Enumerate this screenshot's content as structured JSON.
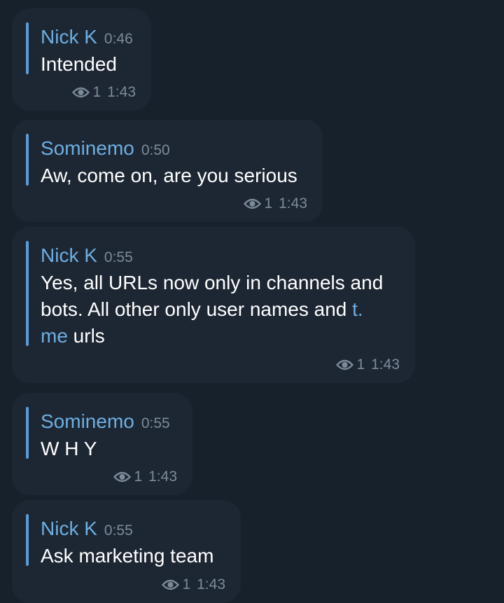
{
  "messages": [
    {
      "sender": "Nick K",
      "fwd_time": "0:46",
      "text": "Intended",
      "views": "1",
      "time": "1:43"
    },
    {
      "sender": "Sominemo",
      "fwd_time": "0:50",
      "text": "Aw, come on, are you serious",
      "views": "1",
      "time": "1:43"
    },
    {
      "sender": "Nick K",
      "fwd_time": "0:55",
      "text_line1": "Yes, all URLs now only in channels and",
      "text_line2_pre": "bots. All other only user names and ",
      "text_line2_link": "t.",
      "text_line3_link": "me",
      "text_line3_post": " urls",
      "views": "1",
      "time": "1:43"
    },
    {
      "sender": "Sominemo",
      "fwd_time": "0:55",
      "text": "W H Y",
      "views": "1",
      "time": "1:43"
    },
    {
      "sender": "Nick K",
      "fwd_time": "0:55",
      "text": "Ask marketing team",
      "views": "1",
      "time": "1:43"
    }
  ],
  "icons": {
    "views": "eye-icon"
  },
  "colors": {
    "background": "#17212b",
    "bubble": "#1d2733",
    "accent": "#6eaee2",
    "text": "#ffffff",
    "meta": "#7d8b99"
  }
}
